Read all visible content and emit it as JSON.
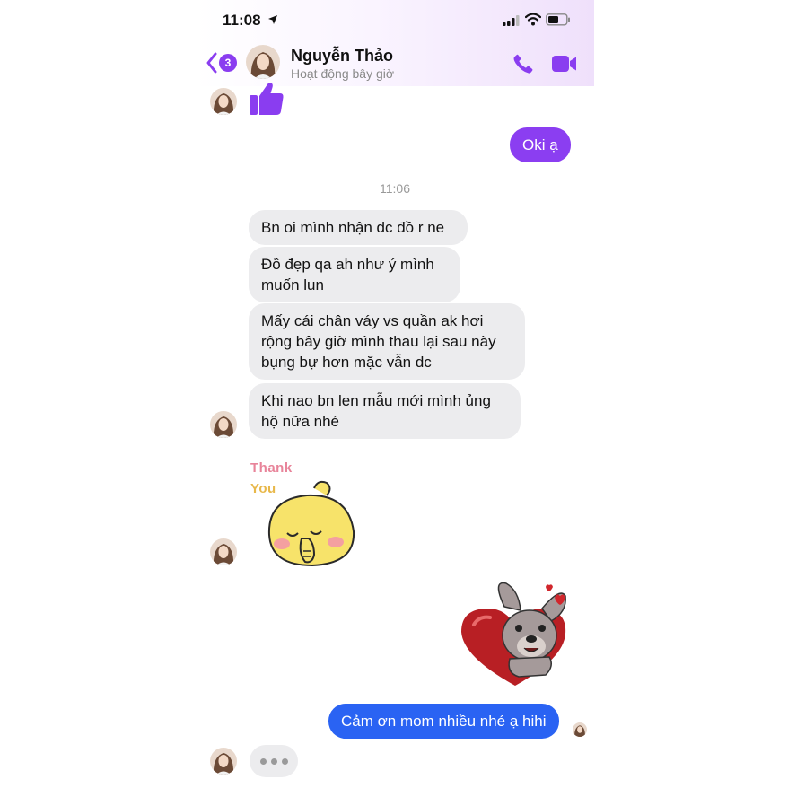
{
  "status_bar": {
    "time": "11:08"
  },
  "header": {
    "back_badge": "3",
    "contact_name": "Nguyễn Thảo",
    "contact_status": "Hoạt động bây giờ"
  },
  "messages": {
    "out_1": "Oki ạ",
    "timestamp": "11:06",
    "in_1": "Bn oi mình nhận dc đồ r ne",
    "in_2": "Đồ đẹp qa ah như ý mình\nmuốn lun",
    "in_3": "Mấy cái chân váy vs quần ak hơi\nrộng bây giờ mình thau lại sau này\nbụng bự hơn mặc vẫn dc",
    "in_4": "Khi nao bn len mẫu mới mình ủng\nhộ nữa nhé",
    "out_2": "Cảm ơn mom nhiều nhé ạ hihi"
  },
  "stickers": {
    "thank_you_line1": "Thank",
    "thank_you_line2": "You"
  },
  "colors": {
    "accent": "#8b3ef1",
    "sent_blue": "#2a63f3",
    "incoming_bubble": "#ececee"
  },
  "icons": [
    "location-arrow-icon",
    "signal-icon",
    "wifi-icon",
    "battery-icon",
    "back-chevron-icon",
    "phone-icon",
    "video-icon",
    "thumbs-up-icon"
  ]
}
